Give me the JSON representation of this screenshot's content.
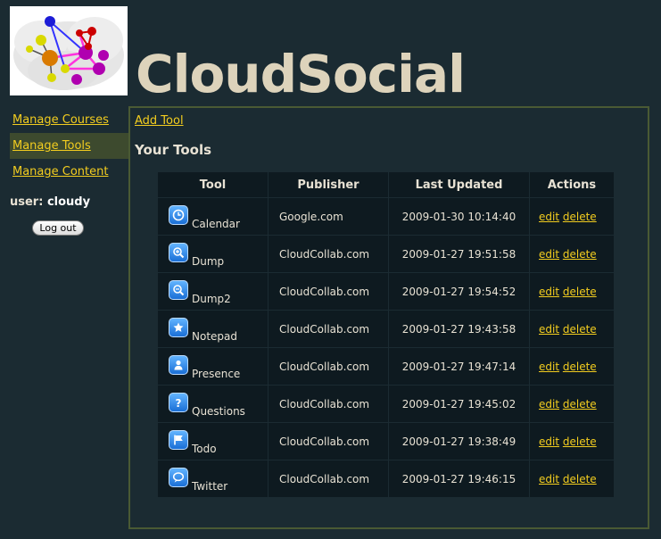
{
  "app": {
    "title": "CloudSocial"
  },
  "sidebar": {
    "items": [
      {
        "label": "Manage Courses",
        "active": false
      },
      {
        "label": "Manage Tools",
        "active": true
      },
      {
        "label": "Manage Content",
        "active": false
      }
    ],
    "user_label": "user:",
    "username": "cloudy",
    "logout_label": "Log out"
  },
  "main": {
    "add_tool_label": "Add Tool",
    "section_title": "Your Tools",
    "table": {
      "headers": [
        "Tool",
        "Publisher",
        "Last Updated",
        "Actions"
      ],
      "rows": [
        {
          "tool": "Calendar",
          "icon": "clock-icon",
          "publisher": "Google.com",
          "updated": "2009-01-30 10:14:40",
          "edit": "edit",
          "delete": "delete"
        },
        {
          "tool": "Dump",
          "icon": "magnifier-plus-icon",
          "publisher": "CloudCollab.com",
          "updated": "2009-01-27 19:51:58",
          "edit": "edit",
          "delete": "delete"
        },
        {
          "tool": "Dump2",
          "icon": "magnifier-minus-icon",
          "publisher": "CloudCollab.com",
          "updated": "2009-01-27 19:54:52",
          "edit": "edit",
          "delete": "delete"
        },
        {
          "tool": "Notepad",
          "icon": "star-icon",
          "publisher": "CloudCollab.com",
          "updated": "2009-01-27 19:43:58",
          "edit": "edit",
          "delete": "delete"
        },
        {
          "tool": "Presence",
          "icon": "person-icon",
          "publisher": "CloudCollab.com",
          "updated": "2009-01-27 19:47:14",
          "edit": "edit",
          "delete": "delete"
        },
        {
          "tool": "Questions",
          "icon": "question-icon",
          "publisher": "CloudCollab.com",
          "updated": "2009-01-27 19:45:02",
          "edit": "edit",
          "delete": "delete"
        },
        {
          "tool": "Todo",
          "icon": "flag-icon",
          "publisher": "CloudCollab.com",
          "updated": "2009-01-27 19:38:49",
          "edit": "edit",
          "delete": "delete"
        },
        {
          "tool": "Twitter",
          "icon": "speech-bubble-icon",
          "publisher": "CloudCollab.com",
          "updated": "2009-01-27 19:46:15",
          "edit": "edit",
          "delete": "delete"
        }
      ]
    }
  },
  "colors": {
    "background": "#1b2b32",
    "link": "#f3cd1f",
    "title": "#ddd3bb",
    "active_nav": "#3d4a2e",
    "panel_border": "#4a5a34",
    "cell_bg": "#0e1a20",
    "icon_blue": "#1a6fd6"
  }
}
